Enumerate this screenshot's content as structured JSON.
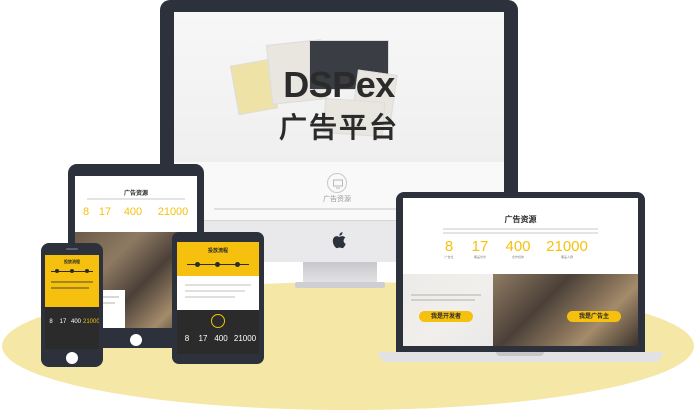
{
  "colors": {
    "device_frame": "#2d313b",
    "accent_yellow": "#f5c10e",
    "floor": "#f5e7a6"
  },
  "hero": {
    "title": "DSPex",
    "subtitle": "广告平台"
  },
  "section": {
    "title": "广告资源",
    "stats": [
      {
        "value": "8",
        "sup": "",
        "label": "广告位"
      },
      {
        "value": "17",
        "sup": "",
        "label": "覆盖省份"
      },
      {
        "value": "400",
        "sup": "+",
        "label": "合作媒体"
      },
      {
        "value": "21000",
        "sup": "+",
        "label": "覆盖人群"
      }
    ]
  },
  "laptop": {
    "buttons": [
      "我是开发者",
      "我是广告主"
    ]
  },
  "tablet_yellow": {
    "title": "投放流程",
    "stats": [
      "8",
      "17",
      "400",
      "21000"
    ]
  },
  "phone": {
    "title": "投放流程",
    "stats": [
      "8",
      "17",
      "400",
      "21000"
    ]
  },
  "icons": [
    "apple-logo-icon",
    "monitor-icon"
  ]
}
